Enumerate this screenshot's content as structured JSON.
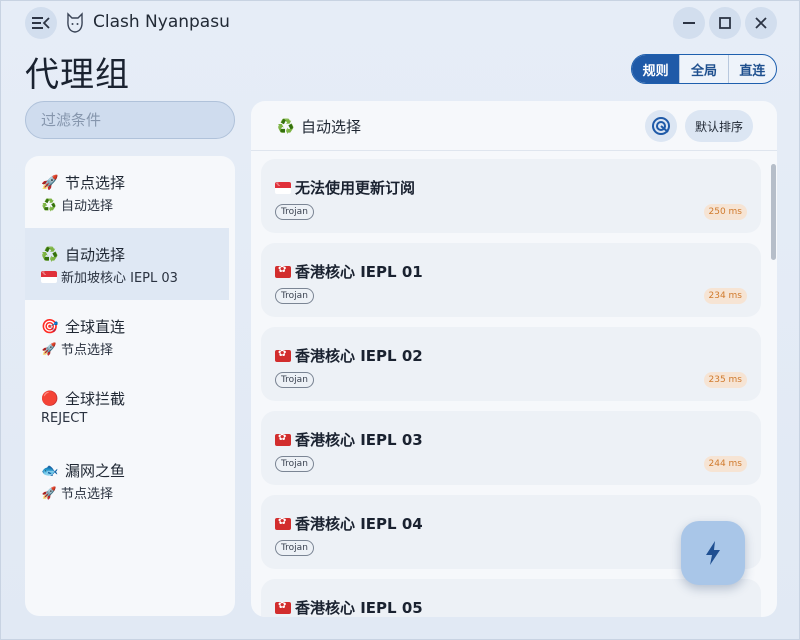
{
  "app": {
    "title": "Clash Nyanpasu"
  },
  "page": {
    "title": "代理组"
  },
  "mode_switch": {
    "options": [
      "规则",
      "全局",
      "直连"
    ],
    "selected": "规则"
  },
  "filter": {
    "placeholder": "过滤条件",
    "value": ""
  },
  "groups": [
    {
      "icon": "🚀",
      "icon_name": "rocket-icon",
      "name": "节点选择",
      "sub_icon": "♻️",
      "sub_icon_name": "recycle-icon",
      "current": "自动选择"
    },
    {
      "icon": "♻️",
      "icon_name": "recycle-icon",
      "name": "自动选择",
      "sub_flag": "sg",
      "current": "新加坡核心 IEPL 03"
    },
    {
      "icon": "🎯",
      "icon_name": "target-icon",
      "name": "全球直连",
      "sub_icon": "🚀",
      "sub_icon_name": "rocket-icon",
      "current": "节点选择"
    },
    {
      "icon": "🔴",
      "icon_name": "red-circle-icon",
      "name": "全球拦截",
      "current": "REJECT"
    },
    {
      "icon": "🐟",
      "icon_name": "fish-icon",
      "name": "漏网之鱼",
      "sub_icon": "🚀",
      "sub_icon_name": "rocket-icon",
      "current": "节点选择"
    }
  ],
  "selected_group_index": 1,
  "panel": {
    "icon": "♻️",
    "title": "自动选择",
    "sort_label": "默认排序"
  },
  "proxies": [
    {
      "flag": "sg",
      "name": "无法使用更新订阅",
      "type": "Trojan",
      "delay": "250 ms"
    },
    {
      "flag": "hk",
      "name": "香港核心 IEPL 01",
      "type": "Trojan",
      "delay": "234 ms"
    },
    {
      "flag": "hk",
      "name": "香港核心 IEPL 02",
      "type": "Trojan",
      "delay": "235 ms"
    },
    {
      "flag": "hk",
      "name": "香港核心 IEPL 03",
      "type": "Trojan",
      "delay": "244 ms"
    },
    {
      "flag": "hk",
      "name": "香港核心 IEPL 04",
      "type": "Trojan",
      "delay": ""
    },
    {
      "flag": "hk",
      "name": "香港核心 IEPL 05",
      "type": "",
      "delay": ""
    }
  ],
  "colors": {
    "accent": "#1f5aa8",
    "background": "#e3ebf5",
    "delay_text": "#d07a2d",
    "fab": "#a9c6e8"
  }
}
